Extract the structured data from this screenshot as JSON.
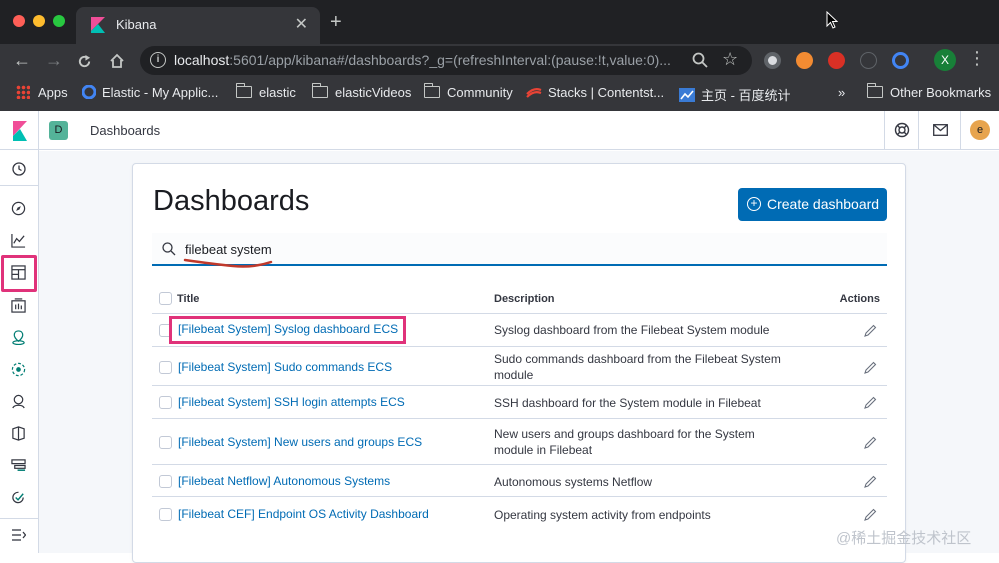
{
  "browser": {
    "tab_title": "Kibana",
    "tab_close": "✕",
    "new_tab": "+",
    "url_host": "localhost",
    "url_rest": ":5601/app/kibana#/dashboards?_g=(refreshInterval:(pause:!t,value:0)...",
    "profile_initial": "X",
    "extension_icons": [
      "chrome-ext-icon",
      "network-ext-icon",
      "block-ext-icon",
      "info-ext-icon",
      "circle-ext-icon"
    ]
  },
  "bookmarks": [
    {
      "label": "Apps",
      "icon": "apps-grid-icon"
    },
    {
      "label": "Elastic - My Applic...",
      "icon": "elastic-icon"
    },
    {
      "label": "elastic",
      "icon": "folder-icon"
    },
    {
      "label": "elasticVideos",
      "icon": "folder-icon"
    },
    {
      "label": "Community",
      "icon": "folder-icon"
    },
    {
      "label": "Stacks | Contentst...",
      "icon": "stacks-icon"
    },
    {
      "label": "主页 - 百度统计",
      "icon": "baidu-tongji-icon"
    },
    {
      "label": "»",
      "icon": ""
    },
    {
      "label": "Other Bookmarks",
      "icon": "folder-icon"
    }
  ],
  "kibana": {
    "space_initial": "D",
    "breadcrumb": "Dashboards",
    "user_initial": "e",
    "nav_items": [
      "clock-icon",
      "discover-icon",
      "visualize-icon",
      "dashboard-icon",
      "canvas-icon",
      "maps-icon",
      "ml-icon",
      "infrastructure-icon",
      "logs-icon",
      "apm-icon",
      "uptime-icon",
      "dev-tools-icon",
      "collapse-icon"
    ]
  },
  "page": {
    "title": "Dashboards",
    "create_button": "Create dashboard",
    "search_value": "filebeat system",
    "columns": {
      "title": "Title",
      "description": "Description",
      "actions": "Actions"
    },
    "rows": [
      {
        "title": "[Filebeat System] Syslog dashboard ECS",
        "description": "Syslog dashboard from the Filebeat System module"
      },
      {
        "title": "[Filebeat System] Sudo commands ECS",
        "description": "Sudo commands dashboard from the Filebeat System module"
      },
      {
        "title": "[Filebeat System] SSH login attempts ECS",
        "description": "SSH dashboard for the System module in Filebeat"
      },
      {
        "title": "[Filebeat System] New users and groups ECS",
        "description": "New users and groups dashboard for the System module in Filebeat"
      },
      {
        "title": "[Filebeat Netflow] Autonomous Systems",
        "description": "Autonomous systems Netflow"
      },
      {
        "title": "[Filebeat CEF] Endpoint OS Activity Dashboard",
        "description": "Operating system activity from endpoints"
      }
    ]
  },
  "watermark": "@稀土掘金技术社区",
  "colors": {
    "accent": "#006bb4",
    "highlight": "#e0327a",
    "space": "#54b399",
    "user": "#e7a44e"
  }
}
